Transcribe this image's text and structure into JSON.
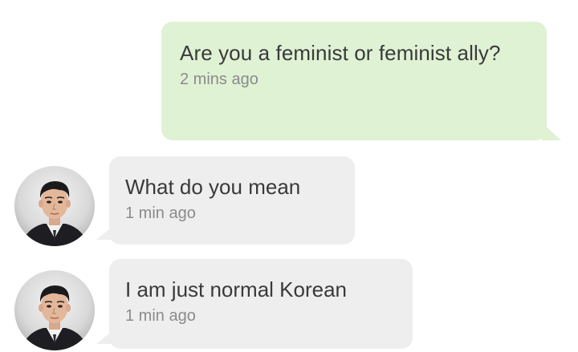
{
  "messages": {
    "sent": [
      {
        "text": "Are you a feminist or feminist ally?",
        "time": "2 mins ago",
        "bubble_color": "#dff2d4"
      }
    ],
    "received": [
      {
        "text": "What do you mean",
        "time": "1 min ago",
        "avatar_icon": "user-avatar-photo",
        "bubble_color": "#eeeeee"
      },
      {
        "text": "I am just normal Korean",
        "time": "1 min ago",
        "avatar_icon": "user-avatar-photo",
        "bubble_color": "#eeeeee"
      }
    ]
  }
}
